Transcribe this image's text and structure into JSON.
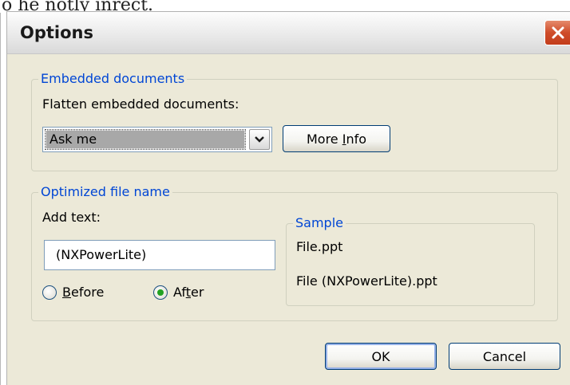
{
  "background": {
    "snippet_text": "o he notly inrect."
  },
  "window": {
    "title": "Options"
  },
  "embedded": {
    "legend": "Embedded documents",
    "flatten_label": "Flatten embedded documents:",
    "selected_value": "Ask me",
    "more_info_pre": "More ",
    "more_info_acc": "I",
    "more_info_post": "nfo"
  },
  "optimized": {
    "legend": "Optimized file name",
    "add_text_label": "Add text:",
    "add_text_value": "(NXPowerLite)",
    "before_acc": "B",
    "before_rest": "efore",
    "before_selected": false,
    "after_pre": "Af",
    "after_acc": "t",
    "after_post": "er",
    "after_selected": true,
    "sample": {
      "legend": "Sample",
      "original": "File.ppt",
      "result": "File (NXPowerLite).ppt"
    }
  },
  "buttons": {
    "ok": "OK",
    "cancel": "Cancel"
  },
  "colors": {
    "legend": "#0046d5",
    "close": "#cf4d2a",
    "radio_dot": "#21a121"
  }
}
